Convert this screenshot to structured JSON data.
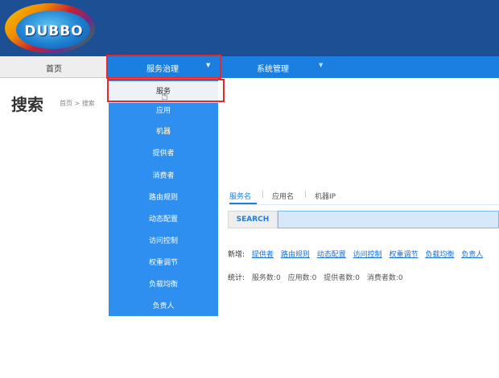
{
  "brand": {
    "logo_text": "DUBBO"
  },
  "nav": {
    "home": "首页",
    "service_gov": "服务治理",
    "system_mgmt": "系统管理",
    "caret": "▼"
  },
  "page": {
    "title": "搜索",
    "breadcrumb": "首页 > 搜索"
  },
  "dropdown": {
    "items": [
      "服务",
      "应用",
      "机器",
      "提供者",
      "消费者",
      "路由规则",
      "动态配置",
      "访问控制",
      "权重调节",
      "负载均衡",
      "负责人"
    ]
  },
  "search": {
    "tabs": [
      "服务名",
      "应用名",
      "机器IP"
    ],
    "tab_separator": "|",
    "button": "SEARCH",
    "input_value": ""
  },
  "new_row": {
    "label": "新增:",
    "links": [
      "提供者",
      "路由规则",
      "动态配置",
      "访问控制",
      "权重调节",
      "负载均衡",
      "负责人"
    ]
  },
  "stats_row": {
    "label": "统计:",
    "items": [
      "服务数:0",
      "应用数:0",
      "提供者数:0",
      "消费者数:0"
    ]
  }
}
